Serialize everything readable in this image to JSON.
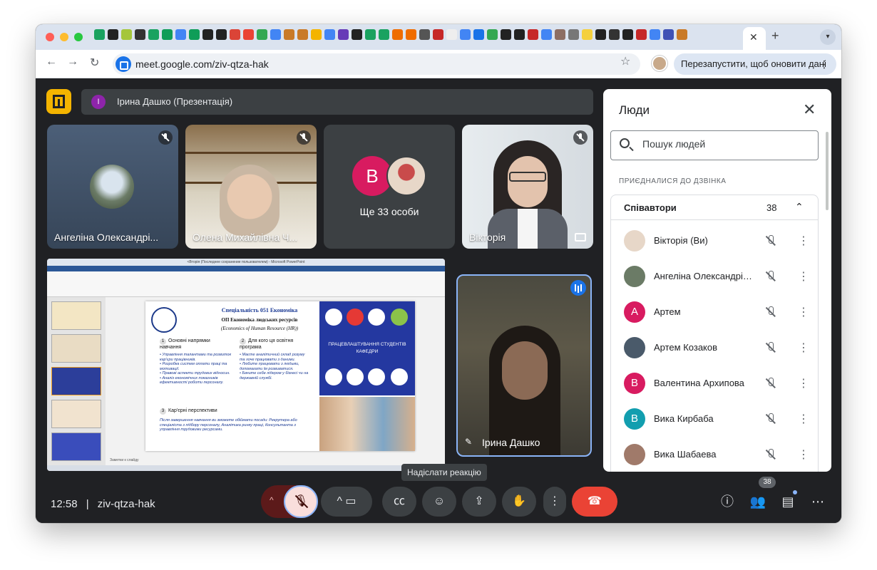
{
  "browser": {
    "url": "meet.google.com/ziv-qtza-hak",
    "relaunch_label": "Перезапустити, щоб оновити дані",
    "new_tab_symbol": "+",
    "close_tab_symbol": "✕",
    "menu_dots": "⋮"
  },
  "meet": {
    "presenting_initial": "I",
    "presenting_label": "Ірина Дашко (Презентація)",
    "tiles": [
      {
        "name": "Ангеліна Олександрі..."
      },
      {
        "name": "Олена Михайлівна Ч..."
      },
      {
        "avatar_letter": "B",
        "more_label": "Ще 33 особи"
      },
      {
        "name": "Вікторія"
      }
    ],
    "speaker_name": "Ірина Дашко"
  },
  "slide": {
    "window_title": "<Вторія (Последнее сохранение пользователем) - Microsoft PowerPoint",
    "title_specialty": "Спеціальність 051 Економіка",
    "title_program": "ОП Економіка людських ресурсів",
    "title_english": "(Economics of Human Resource (HR))",
    "section_1": "Основні напрямки навчання",
    "section_2": "Для кого ця освітня програма",
    "section_3": "Кар'єрні перспективи",
    "bullets_1": "• Управління талантами та розвиток кар'єри працівників.\n• Розробка систем оплати праці та мотивації.\n• Правові аспекти трудових відносин.\n• Аналіз економічних показників ефективності роботи персоналу.",
    "bullets_2": "• Маєте аналітичний склад розуму та хоче працювати з даними.\n• Любите працювати з людьми, допомагати їм розвиватися.\n• Бачите себе лідером у бізнесі чи на державній службі.",
    "bullets_3": "Після завершення навчання ви зможете обіймати посади: Рекрутера або спеціаліста з підбору персоналу, Аналітика ринку праці, Консультанта з управління трудовими ресурсами.",
    "employment_text": "ПРАЦЕВЛАШТУВАННЯ СТУДЕНТІВ КАФЕДРИ",
    "notes_label": "Заметки к слайду"
  },
  "people_panel": {
    "title": "Люди",
    "search_placeholder": "Пошук людей",
    "section_label": "ПРИЄДНАЛИСЯ ДО ДЗВІНКА",
    "group_label": "Співавтори",
    "group_count": "38",
    "participants": [
      {
        "name": "Вікторія (Ви)",
        "initial": "",
        "color": "#e7d7c8"
      },
      {
        "name": "Ангеліна Олександрів...",
        "initial": "",
        "color": "#6b7b66"
      },
      {
        "name": "Артем",
        "initial": "A",
        "color": "#d81b60"
      },
      {
        "name": "Артем Козаков",
        "initial": "",
        "color": "#4a5a6a"
      },
      {
        "name": "Валентина Архипова",
        "initial": "B",
        "color": "#d81b60"
      },
      {
        "name": "Вика Кирбаба",
        "initial": "B",
        "color": "#129eaf"
      },
      {
        "name": "Вика Шабаева",
        "initial": "",
        "color": "#a07a6a"
      }
    ]
  },
  "bottom_bar": {
    "time": "12:58",
    "separator": "|",
    "meeting_code": "ziv-qtza-hak",
    "tooltip": "Надіслати реакцію",
    "people_count": "38"
  },
  "colors": {
    "meet_bg": "#202124",
    "accent_yellow": "#f4b400",
    "end_call_red": "#ea4335",
    "speaker_border": "#8ab4f8"
  }
}
